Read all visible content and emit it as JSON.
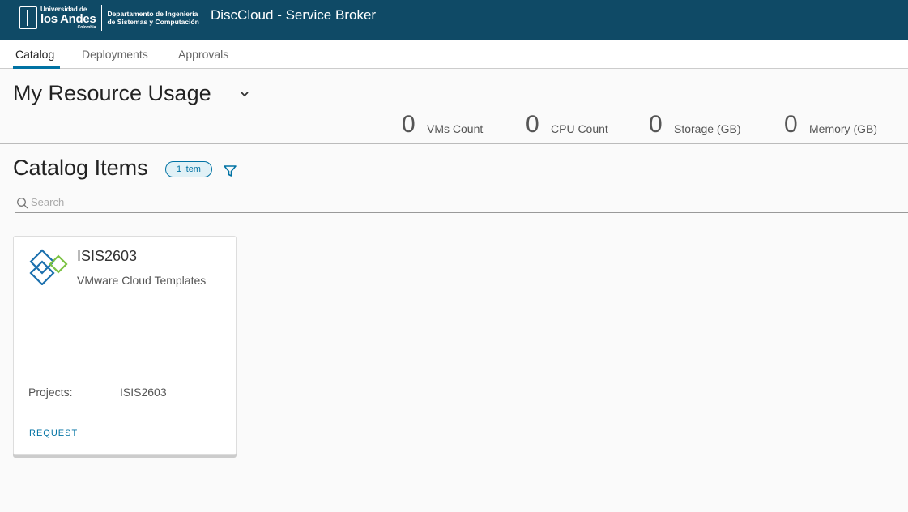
{
  "header": {
    "logo": {
      "university_top": "Universidad de",
      "university_main": "los Andes",
      "university_sub": "Colombia",
      "department_line1": "Departamento de Ingeniería",
      "department_line2": "de Sistemas y Computación"
    },
    "app_title": "DiscCloud - Service Broker",
    "bg_color": "#0f4a66"
  },
  "nav": {
    "tabs": [
      {
        "label": "Catalog",
        "active": true
      },
      {
        "label": "Deployments",
        "active": false
      },
      {
        "label": "Approvals",
        "active": false
      }
    ],
    "accent_color": "#0072a3"
  },
  "usage": {
    "title": "My Resource Usage",
    "stats": [
      {
        "value": "0",
        "label": "VMs Count"
      },
      {
        "value": "0",
        "label": "CPU Count"
      },
      {
        "value": "0",
        "label": "Storage (GB)"
      },
      {
        "value": "0",
        "label": "Memory (GB)"
      }
    ]
  },
  "catalog": {
    "title": "Catalog Items",
    "count_badge": "1 item",
    "search_placeholder": "Search",
    "search_value": "",
    "items": [
      {
        "title": "ISIS2603",
        "subtitle": "VMware Cloud Templates",
        "projects_label": "Projects:",
        "projects_value": "ISIS2603",
        "action_label": "REQUEST",
        "icon": "vmware-cloud-template-icon"
      }
    ]
  }
}
